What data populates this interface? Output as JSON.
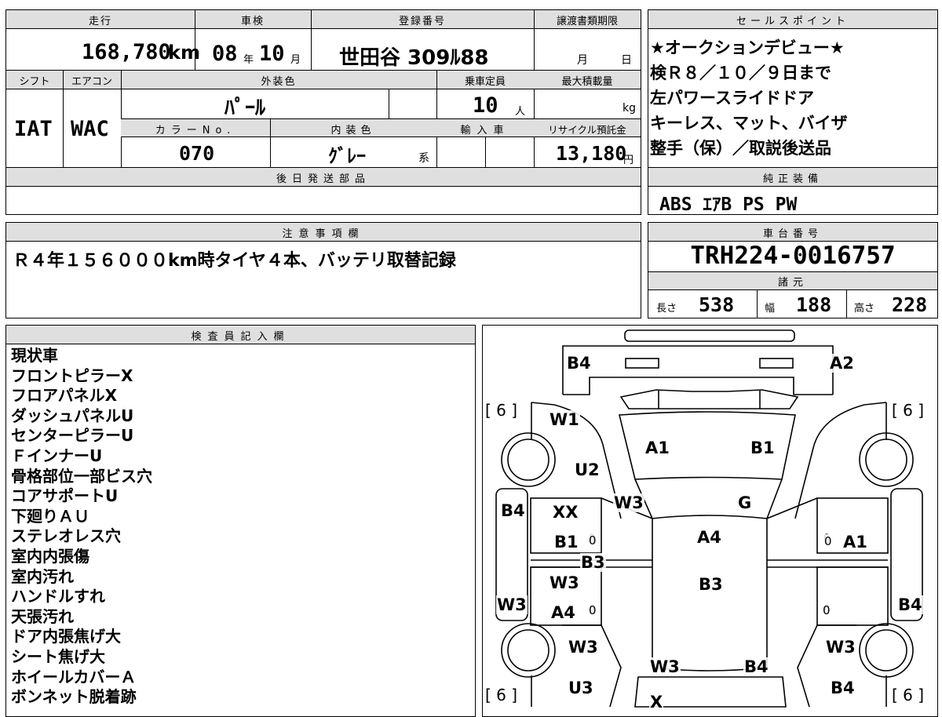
{
  "top": {
    "h_mileage": "走行",
    "mileage": "168,780",
    "mileage_unit": "km",
    "h_shaken": "車検",
    "shaken_year": "08",
    "shaken_year_unit": "年",
    "shaken_month": "10",
    "shaken_month_unit": "月",
    "h_reg": "登録番号",
    "reg_no": "世田谷 309ﾙ88",
    "h_transfer": "譲渡書類期限",
    "transfer_month": "月",
    "transfer_day": "日",
    "h_shift": "シフト",
    "shift": "IAT",
    "h_ac": "エアコン",
    "ac": "WAC",
    "h_color": "外装色",
    "color": "ﾊﾟｰﾙ",
    "h_capacity": "乗車定員",
    "capacity": "10",
    "capacity_unit": "人",
    "h_load": "最大積載量",
    "load_unit": "kg",
    "h_colorno": "カラーNo.",
    "color_no": "070",
    "h_interior": "内装色",
    "interior": "ｸﾞﾚｰ",
    "interior_suffix": "系",
    "h_import": "輸入車",
    "h_recycle": "リサイクル預託金",
    "recycle": "13,180",
    "recycle_unit": "円",
    "h_later": "後日発送部品"
  },
  "sales": {
    "header": "セールスポイント",
    "lines": [
      "★オークションデビュー★",
      "検Ｒ８／１０／９日まで",
      "左パワースライドドア",
      "キーレス、マット、バイザ",
      "整手（保）／取説後送品"
    ]
  },
  "equipment": {
    "header": "純正装備",
    "value": "ABS ｴｱB PS PW"
  },
  "notes": {
    "header": "注意事項欄",
    "text": "Ｒ４年１５６０００km時タイヤ４本、バッテリ取替記録"
  },
  "chassis": {
    "header": "車台番号",
    "value": "TRH224-0016757"
  },
  "specs": {
    "header": "諸元",
    "len_label": "長さ",
    "len": "538",
    "wid_label": "幅",
    "wid": "188",
    "hgt_label": "高さ",
    "hgt": "228"
  },
  "inspector": {
    "header": "検査員記入欄",
    "lines": [
      "現状車",
      "フロントピラーX",
      "フロアパネルX",
      "ダッシュパネルU",
      "センターピラーU",
      "ＦインナーU",
      "骨格部位一部ビス穴",
      "コアサポートU",
      "下廻りＡＵ",
      "ステレオレス穴",
      "室内内張傷",
      "室内汚れ",
      "ハンドルすれ",
      "天張汚れ",
      "ドア内張焦げ大",
      "シート焦げ大",
      "ホイールカバーＡ",
      "ボンネット脱着跡"
    ]
  },
  "diagram": {
    "tires": [
      "[ 6 ]",
      "[ 6 ]",
      "[ 6 ]",
      "[ 6 ]"
    ],
    "marks": [
      "B4",
      "A2",
      "W1",
      "A1",
      "B1",
      "U2",
      "W3",
      "G",
      "B4",
      "XX",
      "B1",
      "0",
      "B3",
      "A4",
      "0",
      "A1",
      "W3",
      "B3",
      "W3",
      "A4",
      "0",
      "0",
      "B4",
      "W3",
      "W3",
      "W3",
      "B4",
      "U3",
      "B4",
      "X"
    ]
  }
}
